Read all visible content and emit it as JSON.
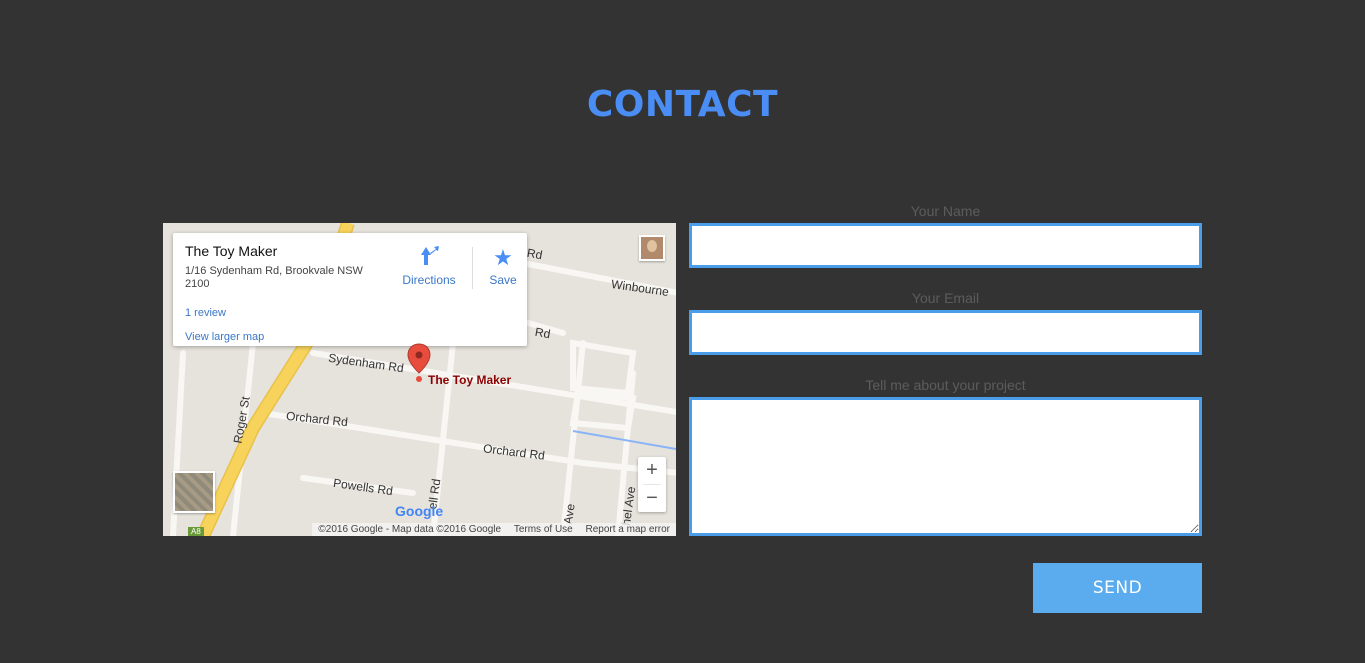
{
  "section": {
    "title": "CONTACT"
  },
  "map": {
    "info_card": {
      "place_name": "The Toy Maker",
      "address": "1/16 Sydenham Rd, Brookvale NSW 2100",
      "reviews_link": "1 review",
      "larger_map_link": "View larger map",
      "directions_label": "Directions",
      "save_label": "Save"
    },
    "marker_label": "The Toy Maker",
    "street_labels": {
      "sydenham": "Sydenham Rd",
      "orchard_left": "Orchard Rd",
      "orchard_right": "Orchard Rd",
      "powells": "Powells Rd",
      "roger": "Roger St",
      "winbourne": "Winbourne",
      "rd_upper": "Rd",
      "rd_top": "Rd",
      "ave_1": "Ave",
      "ave_2": "hel Ave",
      "bell": "ell Rd"
    },
    "route_badge": "A8",
    "zoom_in": "+",
    "zoom_out": "−",
    "logo": "Google",
    "attribution": {
      "copyright": "©2016 Google - Map data ©2016 Google",
      "terms": "Terms of Use",
      "report": "Report a map error"
    },
    "colors": {
      "marker": "#e74c3c",
      "main_road": "#f7d35c",
      "water": "#8ab4f8"
    }
  },
  "form": {
    "name_label": "Your Name",
    "name_value": "",
    "email_label": "Your Email",
    "email_value": "",
    "project_label": "Tell me about your project",
    "project_value": "",
    "submit_label": "SEND"
  },
  "colors": {
    "background": "#333333",
    "accent": "#4a8ef5",
    "button": "#5aacef",
    "field_border": "#4a9de8"
  }
}
